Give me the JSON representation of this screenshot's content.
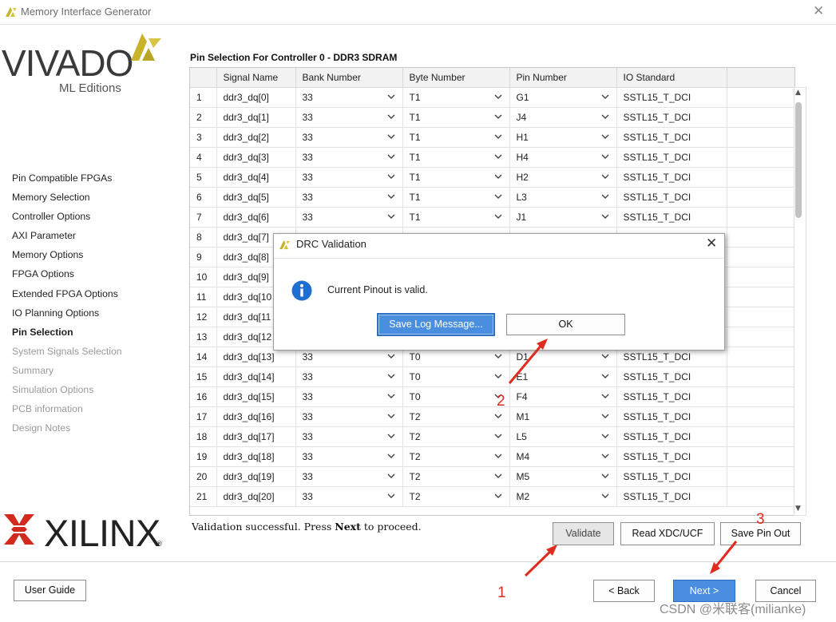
{
  "window": {
    "title": "Memory Interface Generator"
  },
  "branding": {
    "vivado": "VIVADO",
    "ml_editions": "ML Editions",
    "xilinx": "XILINX",
    "registered": "®"
  },
  "nav": {
    "items": [
      {
        "label": "Pin Compatible FPGAs",
        "state": "normal"
      },
      {
        "label": "Memory Selection",
        "state": "normal"
      },
      {
        "label": "Controller Options",
        "state": "normal"
      },
      {
        "label": "AXI Parameter",
        "state": "normal"
      },
      {
        "label": "Memory Options",
        "state": "normal"
      },
      {
        "label": "FPGA Options",
        "state": "normal"
      },
      {
        "label": "Extended FPGA Options",
        "state": "normal"
      },
      {
        "label": "IO Planning Options",
        "state": "normal"
      },
      {
        "label": "Pin Selection",
        "state": "active"
      },
      {
        "label": "System Signals Selection",
        "state": "disabled"
      },
      {
        "label": "Summary",
        "state": "disabled"
      },
      {
        "label": "Simulation Options",
        "state": "disabled"
      },
      {
        "label": "PCB information",
        "state": "disabled"
      },
      {
        "label": "Design Notes",
        "state": "disabled"
      }
    ]
  },
  "main": {
    "section_title": "Pin Selection For Controller 0 - DDR3 SDRAM",
    "table": {
      "headers": [
        "",
        "Signal Name",
        "Bank Number",
        "Byte Number",
        "Pin Number",
        "IO Standard"
      ],
      "rows": [
        [
          "1",
          "ddr3_dq[0]",
          "33",
          "T1",
          "G1",
          "SSTL15_T_DCI"
        ],
        [
          "2",
          "ddr3_dq[1]",
          "33",
          "T1",
          "J4",
          "SSTL15_T_DCI"
        ],
        [
          "3",
          "ddr3_dq[2]",
          "33",
          "T1",
          "H1",
          "SSTL15_T_DCI"
        ],
        [
          "4",
          "ddr3_dq[3]",
          "33",
          "T1",
          "H4",
          "SSTL15_T_DCI"
        ],
        [
          "5",
          "ddr3_dq[4]",
          "33",
          "T1",
          "H2",
          "SSTL15_T_DCI"
        ],
        [
          "6",
          "ddr3_dq[5]",
          "33",
          "T1",
          "L3",
          "SSTL15_T_DCI"
        ],
        [
          "7",
          "ddr3_dq[6]",
          "33",
          "T1",
          "J1",
          "SSTL15_T_DCI"
        ],
        [
          "8",
          "ddr3_dq[7]",
          "",
          "",
          "",
          ""
        ],
        [
          "9",
          "ddr3_dq[8]",
          "",
          "",
          "",
          ""
        ],
        [
          "10",
          "ddr3_dq[9]",
          "",
          "",
          "",
          ""
        ],
        [
          "11",
          "ddr3_dq[10",
          "",
          "",
          "",
          ""
        ],
        [
          "12",
          "ddr3_dq[11",
          "",
          "",
          "",
          ""
        ],
        [
          "13",
          "ddr3_dq[12",
          "",
          "",
          "",
          ""
        ],
        [
          "14",
          "ddr3_dq[13]",
          "33",
          "T0",
          "D1",
          "SSTL15_T_DCI"
        ],
        [
          "15",
          "ddr3_dq[14]",
          "33",
          "T0",
          "E1",
          "SSTL15_T_DCI"
        ],
        [
          "16",
          "ddr3_dq[15]",
          "33",
          "T0",
          "F4",
          "SSTL15_T_DCI"
        ],
        [
          "17",
          "ddr3_dq[16]",
          "33",
          "T2",
          "M1",
          "SSTL15_T_DCI"
        ],
        [
          "18",
          "ddr3_dq[17]",
          "33",
          "T2",
          "L5",
          "SSTL15_T_DCI"
        ],
        [
          "19",
          "ddr3_dq[18]",
          "33",
          "T2",
          "M4",
          "SSTL15_T_DCI"
        ],
        [
          "20",
          "ddr3_dq[19]",
          "33",
          "T2",
          "M5",
          "SSTL15_T_DCI"
        ],
        [
          "21",
          "ddr3_dq[20]",
          "33",
          "T2",
          "M2",
          "SSTL15_T_DCI"
        ]
      ]
    },
    "status_text_pre": "Validation successful. Press ",
    "status_text_bold": "Next",
    "status_text_post": " to proceed.",
    "buttons": {
      "validate": "Validate",
      "read_xdc": "Read XDC/UCF",
      "save_pin_out": "Save Pin Out"
    }
  },
  "footer": {
    "user_guide": "User Guide",
    "back": "< Back",
    "next": "Next >",
    "cancel": "Cancel"
  },
  "dialog": {
    "title": "DRC Validation",
    "message": "Current Pinout is valid.",
    "save_log": "Save Log Message...",
    "ok": "OK"
  },
  "annotations": {
    "one": "1",
    "two": "2",
    "three": "3",
    "color": "#e02b1f"
  },
  "watermark": "CSDN @米联客(milianke)",
  "colors": {
    "accent_blue": "#4a8ee0",
    "logo_yellow": "#c9b32a"
  }
}
